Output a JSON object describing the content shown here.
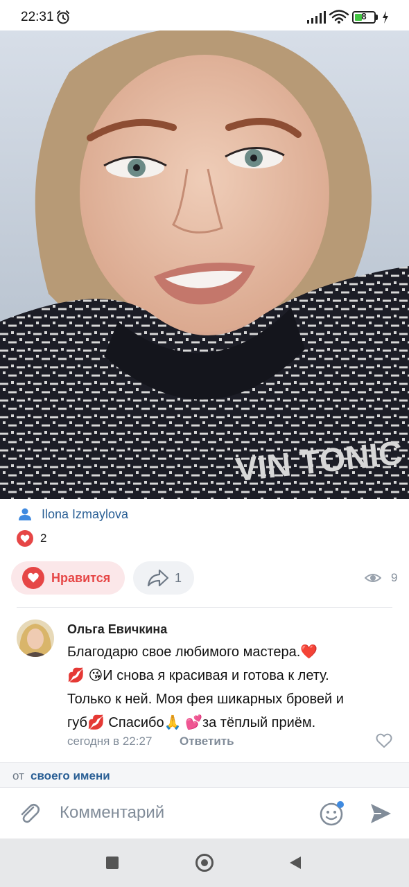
{
  "status_bar": {
    "time": "22:31",
    "battery_level": "8"
  },
  "photo": {
    "sweater_text": "VIN TONIC"
  },
  "post": {
    "author": "Ilona Izmaylova",
    "likes_count": "2",
    "like_button_label": "Нравится",
    "shares_count": "1",
    "views_count": "9"
  },
  "comment": {
    "author": "Ольга Евичкина",
    "lines": [
      "Благодарю свое любимого мастера.❤️",
      "💋 😘И снова я красивая и готова к лету.",
      "Только к ней. Моя фея шикарных бровей и",
      "губ💋 Спасибо🙏 💕за тёплый приём."
    ],
    "time": "сегодня в 22:27",
    "reply_label": "Ответить"
  },
  "post_as": {
    "prefix": "от",
    "link": "своего имени"
  },
  "input": {
    "placeholder": "Комментарий"
  },
  "colors": {
    "accent_blue": "#2a5f95",
    "like_red": "#e64646",
    "secondary_gray": "#818c99"
  }
}
